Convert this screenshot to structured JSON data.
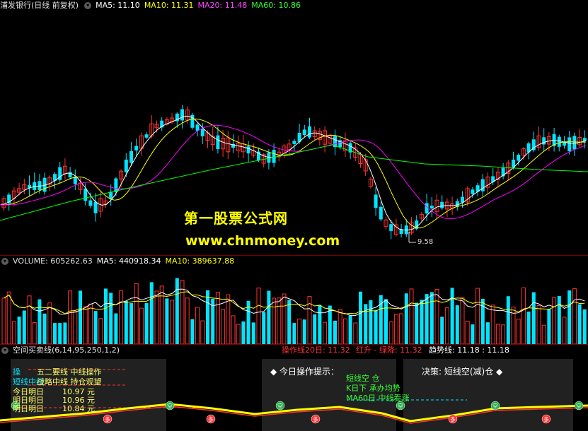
{
  "main": {
    "title": "浦发银行(日线 前复权)",
    "ma5": "MA5: 11.10",
    "ma10": "MA10: 11.31",
    "ma20": "MA20: 11.48",
    "ma60": "MA60: 10.86",
    "min_price_label": "9.58",
    "watermark_name": "第一股票公式网",
    "watermark_url": "www.chnmoney.com"
  },
  "volume": {
    "title": "VOLUME: 605262.63",
    "ma5": "MA5: 440918.34",
    "ma10": "MA10: 389637.88"
  },
  "indicator": {
    "title": "空间买卖线(6,14,95,250,1,2)",
    "line20": "操作线20日: 11.32",
    "rise_fall": "红升 - 绿降: 11.32",
    "trend": "趋势线: 11.18  : 11.18",
    "today_tip": "◆ 今日操作提示：",
    "decision": "决策: 短线空(减)仓 ◆",
    "left_lines": [
      "操",
      "短线中线",
      "今日明日",
      "明日明日",
      "明日明日"
    ],
    "mid_lines": [
      "五二要线 中线操作",
      "战略中线 持仓观望",
      "短线空 仓",
      "K日下 承办均势",
      "MA60日 中线看涨"
    ],
    "nums": [
      "10.97 元",
      "10.96 元",
      "10.84 元"
    ],
    "markers": [
      "空",
      "多",
      "空",
      "多",
      "空",
      "多",
      "空",
      "多",
      "空",
      "多",
      "空"
    ]
  },
  "colors": {
    "up": "#ff3232",
    "down": "#00e5ff",
    "ma5": "#ffffff",
    "ma10": "#ffff00",
    "ma20": "#ff00ff",
    "ma60": "#00ff00",
    "sep": "#7a0000"
  }
}
